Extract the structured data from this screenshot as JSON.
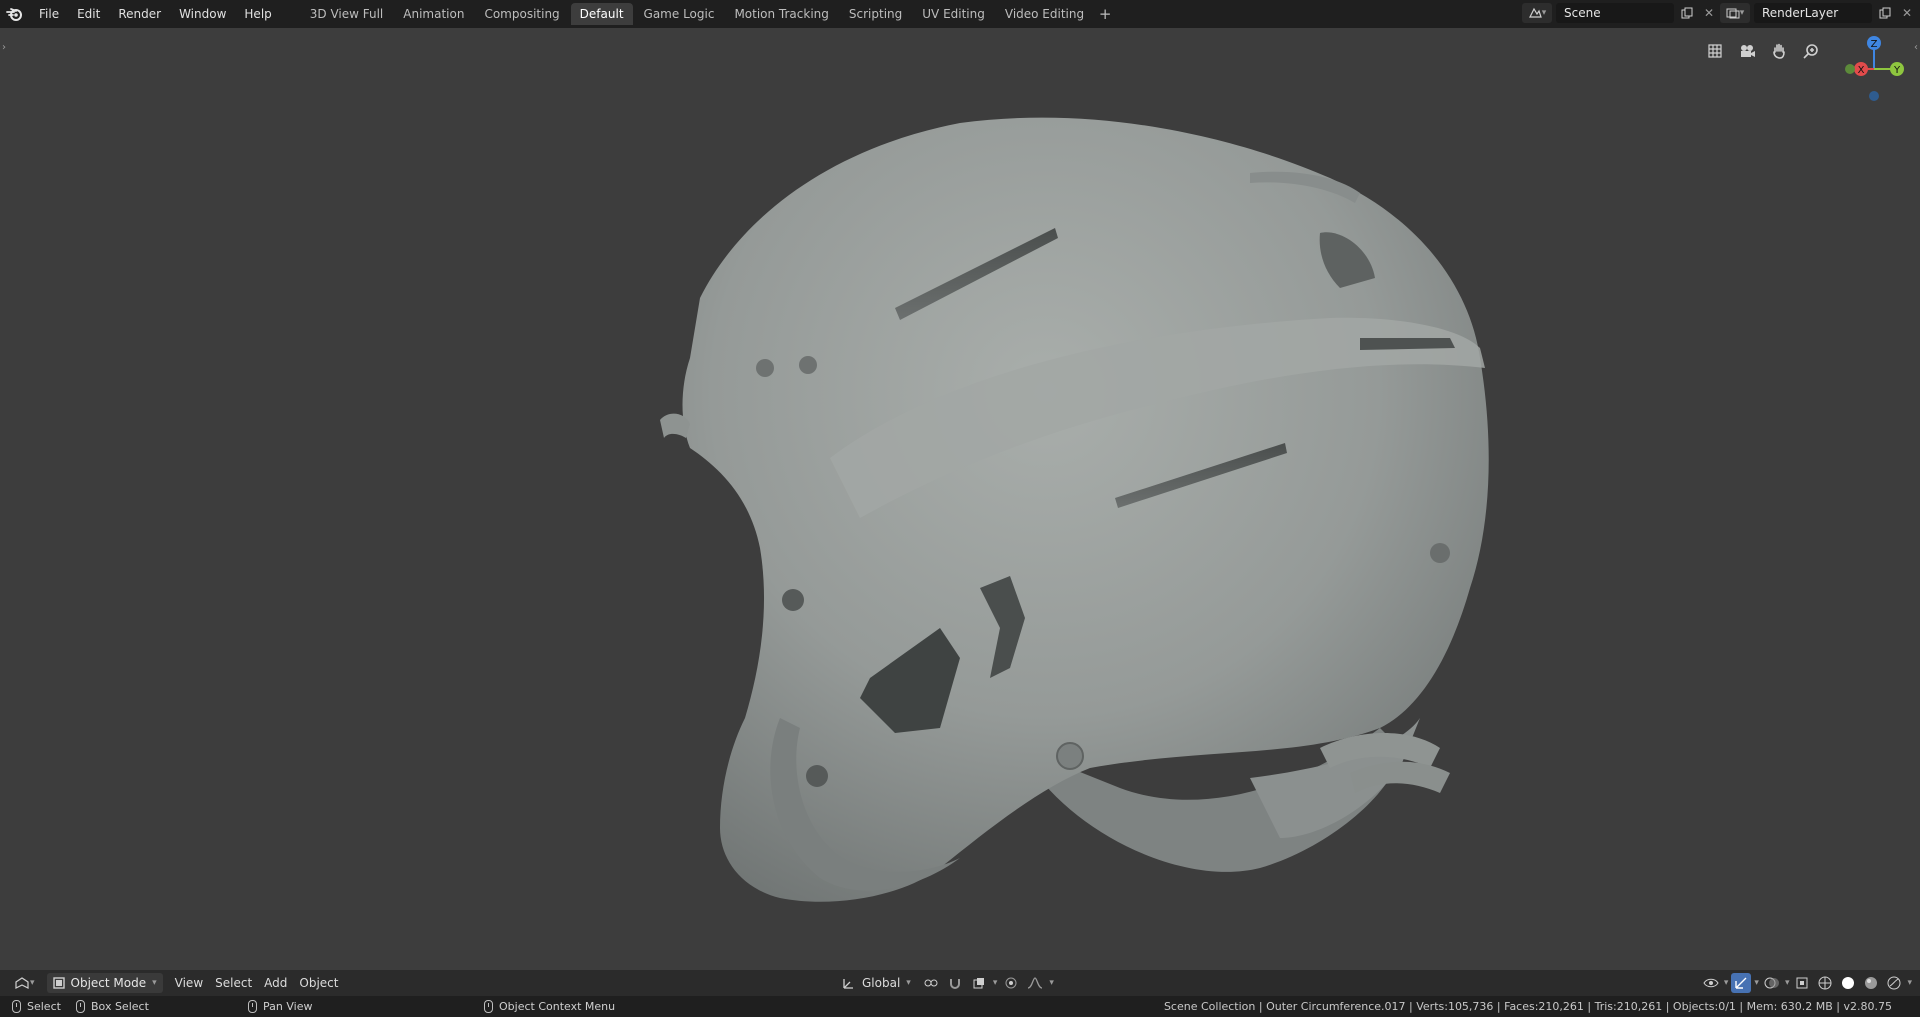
{
  "topbar": {
    "menus": [
      "File",
      "Edit",
      "Render",
      "Window",
      "Help"
    ],
    "workspaces": [
      "3D View Full",
      "Animation",
      "Compositing",
      "Default",
      "Game Logic",
      "Motion Tracking",
      "Scripting",
      "UV Editing",
      "Video Editing"
    ],
    "active_workspace": "Default",
    "add_workspace": "+",
    "scene_name": "Scene",
    "render_layer": "RenderLayer"
  },
  "viewport": {
    "gizmo": {
      "z": "Z",
      "x": "X",
      "y": "Y"
    },
    "tool_icons": [
      "grid-icon",
      "camera-icon",
      "hand-icon",
      "zoom-icon"
    ]
  },
  "header": {
    "mode": "Object Mode",
    "menus": [
      "View",
      "Select",
      "Add",
      "Object"
    ],
    "orientation": "Global"
  },
  "statusbar": {
    "select": "Select",
    "box_select": "Box Select",
    "pan_view": "Pan View",
    "context_menu": "Object Context Menu",
    "stats": "Scene Collection | Outer Circumference.017 | Verts:105,736 | Faces:210,261 | Tris:210,261 | Objects:0/1 | Mem: 630.2 MB | v2.80.75"
  },
  "colors": {
    "topbar_bg": "#1f1f1f",
    "viewport_bg": "#3d3d3d",
    "accent": "#4772b3",
    "axis_x": "#e24b4b",
    "axis_y": "#8ec63f",
    "axis_z": "#3f86e2"
  }
}
